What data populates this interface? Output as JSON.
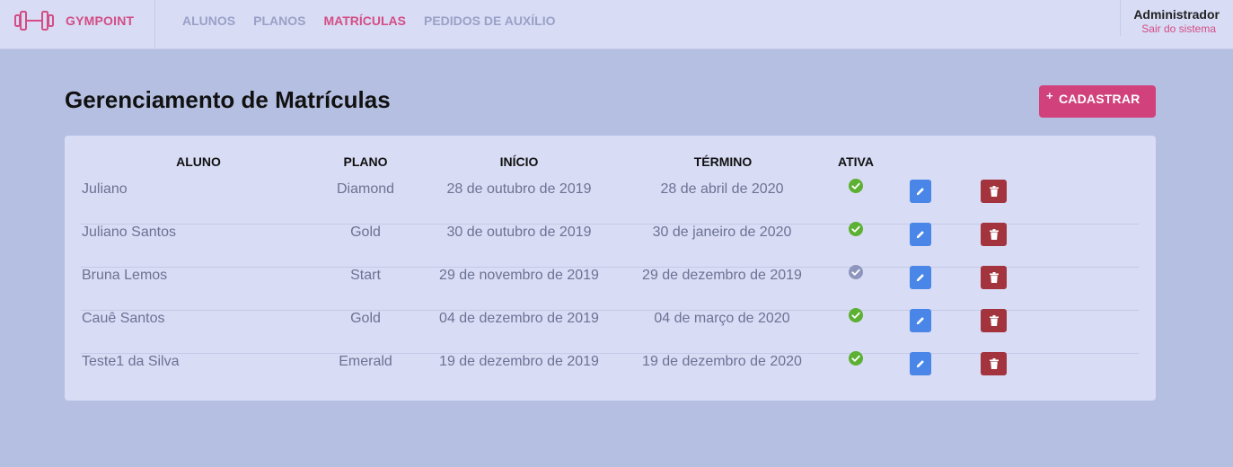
{
  "header": {
    "brand": "GYMPOINT",
    "nav": [
      {
        "label": "ALUNOS",
        "active": false
      },
      {
        "label": "PLANOS",
        "active": false
      },
      {
        "label": "MATRÍCULAS",
        "active": true
      },
      {
        "label": "PEDIDOS DE AUXÍLIO",
        "active": false
      }
    ],
    "user_name": "Administrador",
    "logout_label": "Sair do sistema"
  },
  "page": {
    "title": "Gerenciamento de Matrículas",
    "add_plus": "+",
    "add_label": "CADASTRAR"
  },
  "table": {
    "headers": [
      "ALUNO",
      "PLANO",
      "INÍCIO",
      "TÉRMINO",
      "ATIVA"
    ],
    "rows": [
      {
        "aluno": "Juliano",
        "plano": "Diamond",
        "inicio": "28 de outubro de 2019",
        "termino": "28 de abril de 2020",
        "ativa": true
      },
      {
        "aluno": "Juliano Santos",
        "plano": "Gold",
        "inicio": "30 de outubro de 2019",
        "termino": "30 de janeiro de 2020",
        "ativa": true
      },
      {
        "aluno": "Bruna Lemos",
        "plano": "Start",
        "inicio": "29 de novembro de 2019",
        "termino": "29 de dezembro de 2019",
        "ativa": false
      },
      {
        "aluno": "Cauê Santos",
        "plano": "Gold",
        "inicio": "04 de dezembro de 2019",
        "termino": "04 de março de 2020",
        "ativa": true
      },
      {
        "aluno": "Teste1 da Silva",
        "plano": "Emerald",
        "inicio": "19 de dezembro de 2019",
        "termino": "19 de dezembro de 2020",
        "ativa": true
      }
    ]
  },
  "colors": {
    "brand": "#d44d85",
    "active_status": "#5cb032",
    "inactive_status": "#8f96bd",
    "edit": "#4a86e8",
    "delete": "#a3333c"
  },
  "icons": {
    "brand": "dumbbell-icon",
    "active": "check-circle-icon",
    "inactive": "check-circle-icon",
    "edit": "pencil-icon",
    "delete": "trash-icon"
  }
}
